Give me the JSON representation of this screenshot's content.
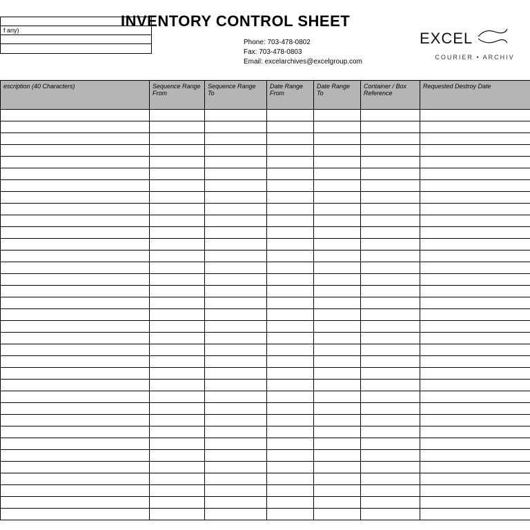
{
  "title": "INVENTORY CONTROL SHEET",
  "info_box": {
    "row1": "",
    "row2": "f any)",
    "row3": "",
    "row4": ""
  },
  "contact": {
    "phone_label": "Phone:",
    "phone_value": "703-478-0802",
    "fax_label": "Fax:",
    "fax_value": "703-478-0803",
    "email_label": "Email:",
    "email_value": "excelarchives@excelgroup.com"
  },
  "brand": {
    "name": "EXCEL",
    "tagline": "COURIER • ARCHIV"
  },
  "columns": [
    "escription (40 Characters)",
    "Sequence Range From",
    "Sequence Range To",
    "Date Range From",
    "Date Range To",
    "Container / Box Reference",
    "Requested Destroy Date"
  ],
  "row_count": 35
}
